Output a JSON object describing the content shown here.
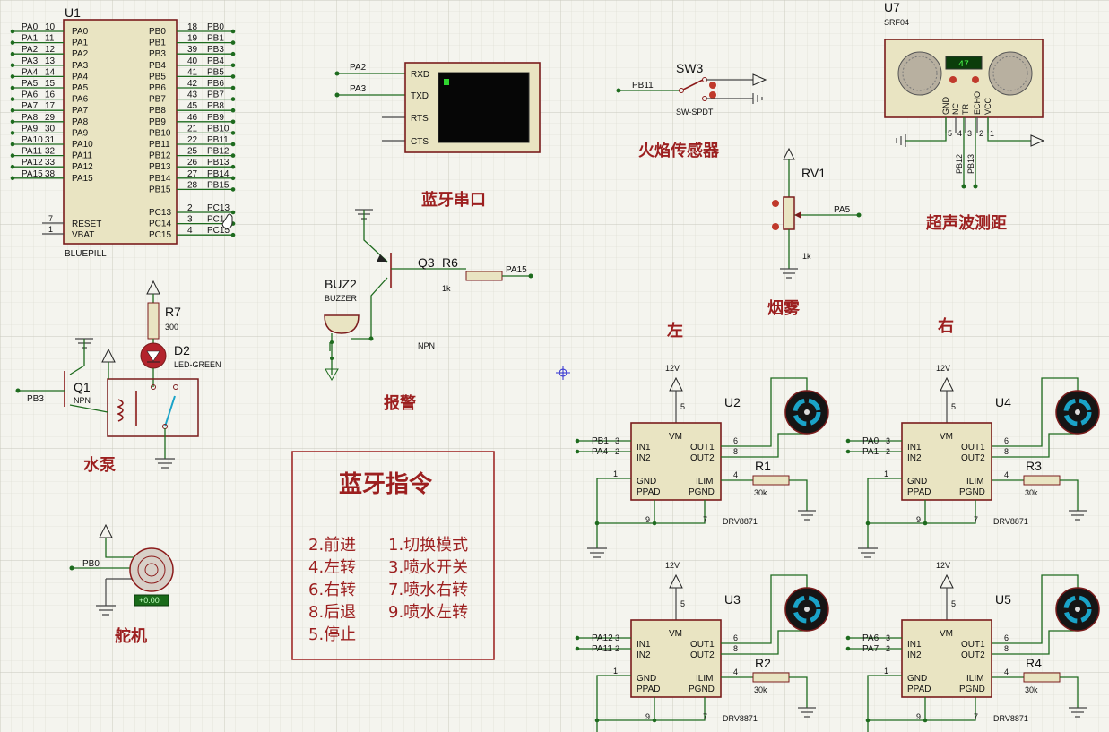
{
  "mcu": {
    "ref": "U1",
    "name": "BLUEPILL",
    "left_pins": [
      {
        "num": "10",
        "pin": "PA0",
        "net": "PA0"
      },
      {
        "num": "11",
        "pin": "PA1",
        "net": "PA1"
      },
      {
        "num": "12",
        "pin": "PA2",
        "net": "PA2"
      },
      {
        "num": "13",
        "pin": "PA3",
        "net": "PA3"
      },
      {
        "num": "14",
        "pin": "PA4",
        "net": "PA4"
      },
      {
        "num": "15",
        "pin": "PA5",
        "net": "PA5"
      },
      {
        "num": "16",
        "pin": "PA6",
        "net": "PA6"
      },
      {
        "num": "17",
        "pin": "PA7",
        "net": "PA7"
      },
      {
        "num": "29",
        "pin": "PA8",
        "net": "PA8"
      },
      {
        "num": "30",
        "pin": "PA9",
        "net": "PA9"
      },
      {
        "num": "31",
        "pin": "PA10",
        "net": "PA10"
      },
      {
        "num": "32",
        "pin": "PA11",
        "net": "PA11"
      },
      {
        "num": "33",
        "pin": "PA12",
        "net": "PA12"
      },
      {
        "num": "38",
        "pin": "PA15",
        "net": "PA15"
      }
    ],
    "right_pins": [
      {
        "num": "18",
        "pin": "PB0",
        "net": "PB0"
      },
      {
        "num": "19",
        "pin": "PB1",
        "net": "PB1"
      },
      {
        "num": "39",
        "pin": "PB3",
        "net": "PB3"
      },
      {
        "num": "40",
        "pin": "PB4",
        "net": "PB4"
      },
      {
        "num": "41",
        "pin": "PB5",
        "net": "PB5"
      },
      {
        "num": "42",
        "pin": "PB6",
        "net": "PB6"
      },
      {
        "num": "43",
        "pin": "PB7",
        "net": "PB7"
      },
      {
        "num": "45",
        "pin": "PB8",
        "net": "PB8"
      },
      {
        "num": "46",
        "pin": "PB9",
        "net": "PB9"
      },
      {
        "num": "21",
        "pin": "PB10",
        "net": "PB10"
      },
      {
        "num": "22",
        "pin": "PB11",
        "net": "PB11"
      },
      {
        "num": "25",
        "pin": "PB12",
        "net": "PB12"
      },
      {
        "num": "26",
        "pin": "PB13",
        "net": "PB13"
      },
      {
        "num": "27",
        "pin": "PB14",
        "net": "PB14"
      },
      {
        "num": "28",
        "pin": "PB15",
        "net": "PB15"
      },
      {
        "num": "2",
        "pin": "PC13",
        "net": "PC13"
      },
      {
        "num": "3",
        "pin": "PC14",
        "net": "PC14"
      },
      {
        "num": "4",
        "pin": "PC15",
        "net": "PC15"
      }
    ],
    "reset": {
      "num": "7",
      "pin": "RESET"
    },
    "vbat": {
      "num": "1",
      "pin": "VBAT"
    }
  },
  "terminal": {
    "pins": [
      "RXD",
      "TXD",
      "RTS",
      "CTS"
    ],
    "nets": [
      "PA2",
      "PA3"
    ],
    "label": "蓝牙串口"
  },
  "switch": {
    "ref": "SW3",
    "type": "SW-SPDT",
    "net": "PB11",
    "label": "火焰传感器"
  },
  "sonar": {
    "ref": "U7",
    "type": "SRF04",
    "display": "47",
    "pins": [
      "GND",
      "NC",
      "TR",
      "ECHO",
      "VCC"
    ],
    "pin_nums": [
      "5",
      "4",
      "3",
      "2",
      "1"
    ],
    "nets": [
      "PB12",
      "PB13"
    ],
    "label": "超声波测距"
  },
  "pot": {
    "ref": "RV1",
    "value": "1k",
    "net": "PA5",
    "label": "烟雾"
  },
  "buzzer": {
    "ref": "BUZ2",
    "type": "BUZZER",
    "transistor": "Q3",
    "transistor_type": "NPN",
    "resistor": "R6",
    "resistor_value": "1k",
    "net": "PA15",
    "label": "报警"
  },
  "pump": {
    "resistor": "R7",
    "resistor_value": "300",
    "led": "D2",
    "led_type": "LED-GREEN",
    "transistor": "Q1",
    "transistor_type": "NPN",
    "net": "PB3",
    "label": "水泵"
  },
  "servo": {
    "net": "PB0",
    "label": "舵机",
    "readout": "+0.00"
  },
  "commands": {
    "title": "蓝牙指令",
    "items": [
      "2.前进",
      "1.切换模式",
      "4.左转",
      "3.喷水开关",
      "6.右转",
      "7.喷水右转",
      "8.后退",
      "9.喷水左转",
      "5.停止"
    ]
  },
  "side_labels": {
    "left": "左",
    "right": "右"
  },
  "drivers": [
    {
      "ref": "U2",
      "in1": "PB1",
      "in2": "PA4",
      "res": "R1",
      "res_value": "30k",
      "vm": "12V",
      "type": "DRV8871"
    },
    {
      "ref": "U4",
      "in1": "PA0",
      "in2": "PA1",
      "res": "R3",
      "res_value": "30k",
      "vm": "12V",
      "type": "DRV8871"
    },
    {
      "ref": "U3",
      "in1": "PA12",
      "in2": "PA11",
      "res": "R2",
      "res_value": "30k",
      "vm": "12V",
      "type": "DRV8871"
    },
    {
      "ref": "U5",
      "in1": "PA6",
      "in2": "PA7",
      "res": "R4",
      "res_value": "30k",
      "vm": "12V",
      "type": "DRV8871"
    }
  ],
  "driver_pins": {
    "vm": "VM",
    "in1": "IN1",
    "in2": "IN2",
    "out1": "OUT1",
    "out2": "OUT2",
    "gnd": "GND",
    "ppad": "PPAD",
    "ilim": "ILIM",
    "pgnd": "PGND",
    "n_vm": "5",
    "n_in1": "3",
    "n_in2": "2",
    "n_out1": "6",
    "n_out2": "8",
    "n_gnd": "1",
    "n_ilim": "4",
    "n_ppad": "9",
    "n_pgnd": "7"
  },
  "colors": {
    "background": "#f4f4ee",
    "component_body": "#e9e4c2",
    "outline": "#7a1c1c",
    "wire": "#1e6b1e",
    "label": "#9c1f1f",
    "motor_ring": "#1aa3c8"
  }
}
